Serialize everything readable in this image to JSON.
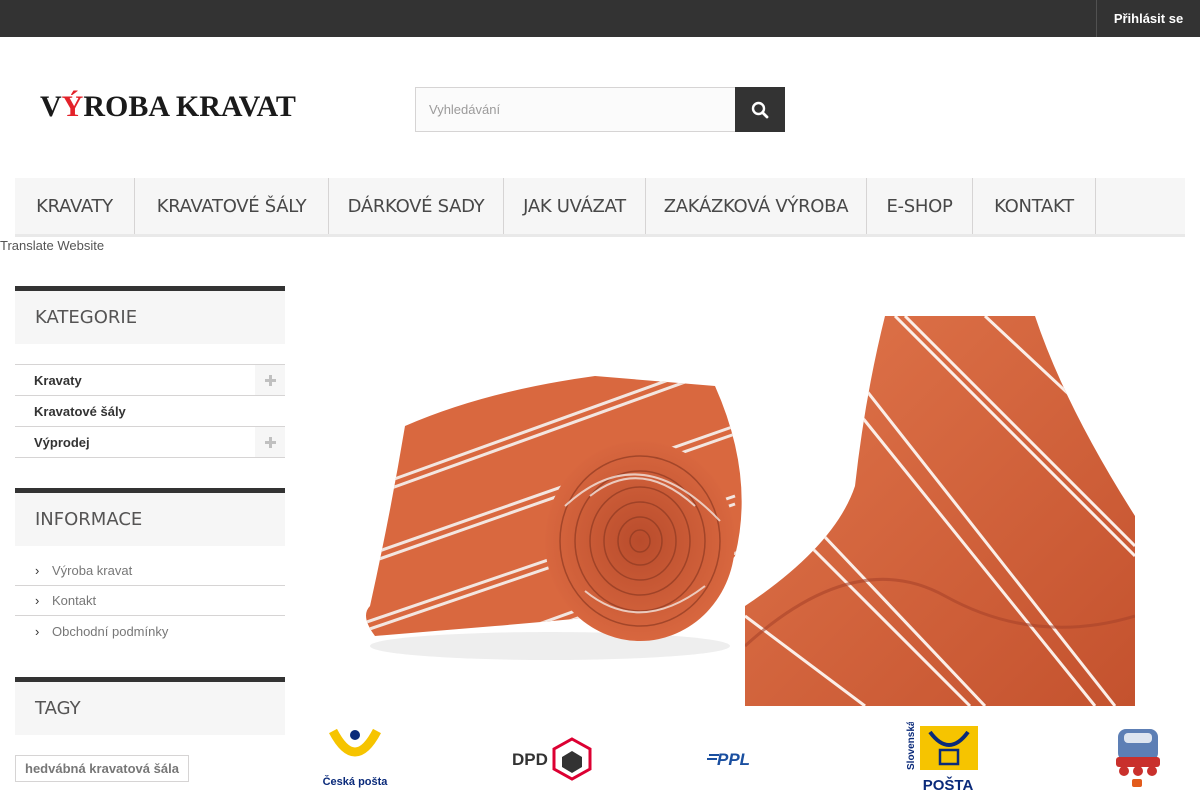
{
  "topbar": {
    "login_label": "Přihlásit se"
  },
  "header": {
    "logo_text_1": "V",
    "logo_text_accent": "Ý",
    "logo_text_2": "ROBA KRAVAT",
    "search_placeholder": "Vyhledávání"
  },
  "nav": {
    "items": [
      {
        "label": "KRAVATY"
      },
      {
        "label": "KRAVATOVÉ ŠÁLY"
      },
      {
        "label": "DÁRKOVÉ SADY"
      },
      {
        "label": "JAK UVÁZAT"
      },
      {
        "label": "ZAKÁZKOVÁ VÝROBA"
      },
      {
        "label": "E-SHOP"
      },
      {
        "label": "KONTAKT"
      }
    ]
  },
  "translate_label": "Translate Website",
  "sidebar": {
    "categories": {
      "title": "KATEGORIE",
      "items": [
        {
          "label": "Kravaty",
          "expandable": true
        },
        {
          "label": "Kravatové šály",
          "expandable": false
        },
        {
          "label": "Výprodej",
          "expandable": true
        }
      ]
    },
    "information": {
      "title": "INFORMACE",
      "items": [
        {
          "label": "Výroba kravat"
        },
        {
          "label": "Kontakt"
        },
        {
          "label": "Obchodní podmínky"
        }
      ]
    },
    "tags": {
      "title": "TAGY",
      "items": [
        {
          "label": "hedvábná kravatová šála"
        }
      ]
    }
  },
  "carriers": {
    "ceska_posta": "Česká pošta",
    "dpd": "DPD",
    "ppl": "PPL",
    "slovenska_1": "Slovenská",
    "slovenska_2": "POŠTA"
  },
  "colors": {
    "topbar": "#333333",
    "tie_orange": "#d4603c",
    "logo_accent": "#e3222a",
    "nav_bg": "#f6f6f6"
  }
}
